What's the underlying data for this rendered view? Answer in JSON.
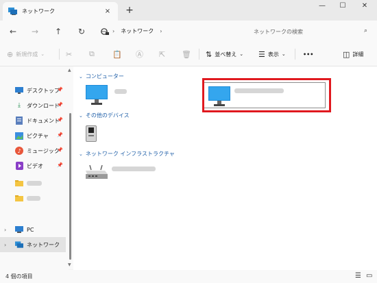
{
  "tab": {
    "title": "ネットワーク",
    "close_icon": "×",
    "new_tab_icon": "+"
  },
  "window": {
    "minimize": "—",
    "maximize": "☐",
    "close": "✕"
  },
  "nav": {
    "back": "←",
    "forward": "→",
    "up": "↑",
    "refresh": "↻",
    "breadcrumb_root": "ネットワーク",
    "breadcrumb_sep": "›",
    "search_placeholder": "ネットワークの検索"
  },
  "toolbar": {
    "new_label": "新規作成",
    "sort_label": "並べ替え",
    "view_label": "表示",
    "more_label": "•••",
    "details_label": "詳細"
  },
  "sidebar": {
    "items": [
      {
        "label": "デスクトップ",
        "icon": "desktop-icon"
      },
      {
        "label": "ダウンロード",
        "icon": "download-icon"
      },
      {
        "label": "ドキュメント",
        "icon": "document-icon"
      },
      {
        "label": "ピクチャ",
        "icon": "picture-icon"
      },
      {
        "label": "ミュージック",
        "icon": "music-icon"
      },
      {
        "label": "ビデオ",
        "icon": "video-icon"
      }
    ],
    "pc_label": "PC",
    "network_label": "ネットワーク"
  },
  "groups": {
    "computers": "コンピューター",
    "other_devices": "その他のデバイス",
    "infrastructure": "ネットワーク インフラストラクチャ"
  },
  "status": {
    "item_count": "4 個の項目"
  },
  "colors": {
    "accent": "#1f5fa8",
    "highlight": "#e0191f",
    "folder": "#f4c542"
  }
}
